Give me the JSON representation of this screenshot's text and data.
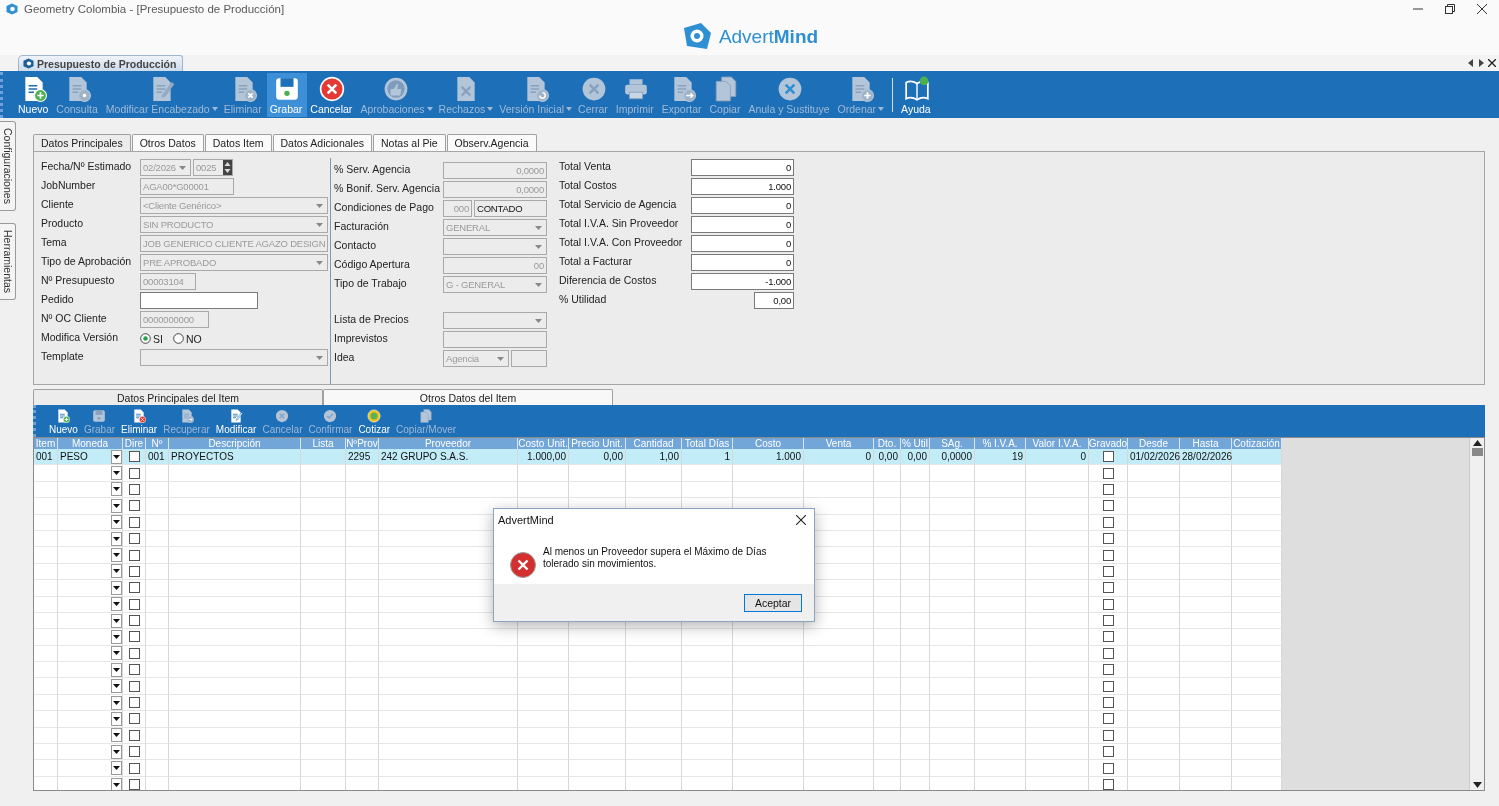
{
  "window": {
    "title": "Geometry Colombia - [Presupuesto de Producción]"
  },
  "logo": {
    "text": "Advert**Mind**"
  },
  "document_tab": {
    "label": "Presupuesto de Producción"
  },
  "toolbar_groups": [
    [
      {
        "label": "Nuevo",
        "kind": "new",
        "enabled": true,
        "selected": false,
        "dropdown": false
      },
      {
        "label": "Consulta",
        "kind": "query",
        "enabled": false,
        "selected": false,
        "dropdown": false
      },
      {
        "label": "Modificar Encabezado",
        "kind": "edit",
        "enabled": false,
        "selected": false,
        "dropdown": true
      },
      {
        "label": "Eliminar",
        "kind": "delete",
        "enabled": false,
        "selected": false,
        "dropdown": false
      },
      {
        "label": "Grabar",
        "kind": "save",
        "enabled": true,
        "selected": true,
        "dropdown": false
      },
      {
        "label": "Cancelar",
        "kind": "cancel",
        "enabled": true,
        "selected": false,
        "dropdown": false
      },
      {
        "label": "Aprobaciones",
        "kind": "approve",
        "enabled": false,
        "selected": false,
        "dropdown": true
      },
      {
        "label": "Rechazos",
        "kind": "reject",
        "enabled": false,
        "selected": false,
        "dropdown": true
      },
      {
        "label": "Versión Inicial",
        "kind": "version",
        "enabled": false,
        "selected": false,
        "dropdown": true
      },
      {
        "label": "Cerrar",
        "kind": "close",
        "enabled": false,
        "selected": false,
        "dropdown": false
      },
      {
        "label": "Imprimir",
        "kind": "print",
        "enabled": false,
        "selected": false,
        "dropdown": false
      },
      {
        "label": "Exportar",
        "kind": "export",
        "enabled": false,
        "selected": false,
        "dropdown": false
      },
      {
        "label": "Copiar",
        "kind": "copy",
        "enabled": false,
        "selected": false,
        "dropdown": false
      },
      {
        "label": "Anula y Sustituye",
        "kind": "void",
        "enabled": false,
        "selected": false,
        "dropdown": false
      },
      {
        "label": "Ordenar",
        "kind": "order",
        "enabled": false,
        "selected": false,
        "dropdown": true
      }
    ],
    [
      {
        "label": "Ayuda",
        "kind": "help",
        "enabled": true,
        "selected": false,
        "dropdown": false
      }
    ]
  ],
  "side_tabs": [
    {
      "label": "Configuraciones"
    },
    {
      "label": "Herramientas"
    }
  ],
  "form_tabs": [
    {
      "label": "Datos Principales",
      "selected": true
    },
    {
      "label": "Otros Datos",
      "selected": false
    },
    {
      "label": "Datos Item",
      "selected": false
    },
    {
      "label": "Datos Adicionales",
      "selected": false
    },
    {
      "label": "Notas al Pie",
      "selected": false
    },
    {
      "label": "Observ.Agencia",
      "selected": false
    }
  ],
  "general_fields": [
    {
      "label": "Fecha/Nº Estimado",
      "kind": "period",
      "value": "02/2026",
      "number": "0025",
      "disabled": true
    },
    {
      "label": "JobNumber",
      "kind": "text",
      "value": "AGA00*G00001",
      "disabled": true
    },
    {
      "label": "Cliente",
      "kind": "select",
      "value": "<Cliente Genérico>",
      "disabled": true
    },
    {
      "label": "Producto",
      "kind": "select",
      "value": "SIN PRODUCTO",
      "disabled": true
    },
    {
      "label": "Tema",
      "kind": "text",
      "value": "JOB GENERICO CLIENTE AGAZO DESIGN",
      "disabled": true
    },
    {
      "label": "Tipo de Aprobación",
      "kind": "select",
      "value": "PRE APROBADO",
      "disabled": true
    },
    {
      "label": "Nº Presupuesto",
      "kind": "text",
      "value": "00003104",
      "disabled": true
    },
    {
      "label": "Pedido",
      "kind": "text",
      "disabled": false
    },
    {
      "label": "Nº OC Cliente",
      "kind": "text",
      "value": "0000000000",
      "disabled": true
    },
    {
      "label": "Modifica Versión",
      "kind": "radio",
      "options": [
        {
          "label": "SI",
          "selected": true
        },
        {
          "label": "NO",
          "selected": false
        }
      ]
    },
    {
      "label": "Template",
      "kind": "select",
      "disabled": true
    }
  ],
  "agency_fields": [
    {
      "label": "% Serv. Agencia",
      "kind": "number",
      "value": "0,0000",
      "disabled": true
    },
    {
      "label": "% Bonif. Serv. Agencia",
      "kind": "number",
      "value": "0,0000",
      "disabled": true
    },
    {
      "label": "Condiciones de Pago",
      "kind": "code",
      "code": "000",
      "value": "CONTADO",
      "disabled": true
    },
    {
      "label": "Facturación",
      "kind": "select",
      "value": "GENERAL",
      "disabled": true
    },
    {
      "label": "Contacto",
      "kind": "select",
      "disabled": true
    },
    {
      "label": "Código Apertura",
      "kind": "number",
      "value": "00",
      "disabled": true
    },
    {
      "label": "Tipo de Trabajo",
      "kind": "select",
      "value": "G - GENERAL",
      "disabled": true
    }
  ],
  "price_fields": [
    {
      "label": "Lista de Precios",
      "kind": "select",
      "disabled": true
    },
    {
      "label": "Imprevistos",
      "kind": "text",
      "disabled": true
    },
    {
      "label": "Idea",
      "kind": "select_text",
      "value": "Agencia",
      "disabled": true
    }
  ],
  "totals": [
    {
      "label": "Total Venta",
      "value": "0"
    },
    {
      "label": "Total Costos",
      "value": "1.000"
    },
    {
      "label": "Total Servicio de Agencia",
      "value": "0"
    },
    {
      "label": "Total I.V.A. Sin Proveedor",
      "value": "0"
    },
    {
      "label": "Total I.V.A. Con Proveedor",
      "value": "0"
    },
    {
      "label": "Total a Facturar",
      "value": "0"
    },
    {
      "label": "Diferencia de Costos",
      "value": "-1.000"
    },
    {
      "label": "% Utilidad",
      "value": "0,00"
    }
  ],
  "item_tabs": [
    {
      "label": "Datos Principales del Item",
      "selected": true
    },
    {
      "label": "Otros Datos del Item",
      "selected": false
    }
  ],
  "item_toolbar": [
    {
      "label": "Nuevo",
      "kind": "new",
      "enabled": true
    },
    {
      "label": "Grabar",
      "kind": "save",
      "enabled": false
    },
    {
      "label": "Eliminar",
      "kind": "delete",
      "enabled": true
    },
    {
      "label": "Recuperar",
      "kind": "recover",
      "enabled": false
    },
    {
      "label": "Modificar",
      "kind": "edit",
      "enabled": true
    },
    {
      "label": "Cancelar",
      "kind": "close",
      "enabled": false
    },
    {
      "label": "Confirmar",
      "kind": "confirm",
      "enabled": false
    },
    {
      "label": "Cotizar",
      "kind": "quote",
      "enabled": true
    },
    {
      "label": "Copiar/Mover",
      "kind": "copy",
      "enabled": false
    }
  ],
  "grid": {
    "columns": [
      {
        "label": "Item",
        "kind": "text"
      },
      {
        "label": "Moneda",
        "kind": "dropdown"
      },
      {
        "label": "Dire",
        "kind": "checkbox"
      },
      {
        "label": "Nº",
        "kind": "text"
      },
      {
        "label": "Descripción",
        "kind": "text"
      },
      {
        "label": "Lista",
        "kind": "text"
      },
      {
        "label": "NºProv",
        "kind": "text"
      },
      {
        "label": "Proveedor",
        "kind": "text"
      },
      {
        "label": "Costo Unit.",
        "kind": "number"
      },
      {
        "label": "Precio Unit.",
        "kind": "number"
      },
      {
        "label": "Cantidad",
        "kind": "number"
      },
      {
        "label": "Total Días",
        "kind": "number"
      },
      {
        "label": "Costo",
        "kind": "number"
      },
      {
        "label": "Venta",
        "kind": "number"
      },
      {
        "label": "Dto.",
        "kind": "number"
      },
      {
        "label": "% Util",
        "kind": "number"
      },
      {
        "label": "SAg.",
        "kind": "number"
      },
      {
        "label": "% I.V.A.",
        "kind": "number"
      },
      {
        "label": "Valor I.V.A.",
        "kind": "number"
      },
      {
        "label": "Gravado",
        "kind": "checkbox"
      },
      {
        "label": "Desde",
        "kind": "text"
      },
      {
        "label": "Hasta",
        "kind": "text"
      },
      {
        "label": "Cotización",
        "kind": "text"
      }
    ],
    "rows": [
      {
        "selected": true,
        "cells": [
          "001",
          "PESO",
          false,
          "001",
          "PROYECTOS",
          null,
          "2295",
          "242 GRUPO S.A.S.",
          "1.000,00",
          "0,00",
          "1,00",
          "1",
          "1.000",
          "0",
          "0,00",
          "0,00",
          "0,0000",
          "19",
          "0",
          false,
          "01/02/2026",
          "28/02/2026",
          null
        ]
      },
      {
        "selected": false,
        "cells": [
          null,
          null,
          false,
          null,
          null,
          null,
          null,
          null,
          null,
          null,
          null,
          null,
          null,
          null,
          null,
          null,
          null,
          null,
          null,
          false,
          null,
          null,
          null
        ]
      },
      {
        "selected": false,
        "cells": [
          null,
          null,
          false,
          null,
          null,
          null,
          null,
          null,
          null,
          null,
          null,
          null,
          null,
          null,
          null,
          null,
          null,
          null,
          null,
          false,
          null,
          null,
          null
        ]
      },
      {
        "selected": false,
        "cells": [
          null,
          null,
          false,
          null,
          null,
          null,
          null,
          null,
          null,
          null,
          null,
          null,
          null,
          null,
          null,
          null,
          null,
          null,
          null,
          false,
          null,
          null,
          null
        ]
      },
      {
        "selected": false,
        "cells": [
          null,
          null,
          false,
          null,
          null,
          null,
          null,
          null,
          null,
          null,
          null,
          null,
          null,
          null,
          null,
          null,
          null,
          null,
          null,
          false,
          null,
          null,
          null
        ]
      },
      {
        "selected": false,
        "cells": [
          null,
          null,
          false,
          null,
          null,
          null,
          null,
          null,
          null,
          null,
          null,
          null,
          null,
          null,
          null,
          null,
          null,
          null,
          null,
          false,
          null,
          null,
          null
        ]
      },
      {
        "selected": false,
        "cells": [
          null,
          null,
          false,
          null,
          null,
          null,
          null,
          null,
          null,
          null,
          null,
          null,
          null,
          null,
          null,
          null,
          null,
          null,
          null,
          false,
          null,
          null,
          null
        ]
      },
      {
        "selected": false,
        "cells": [
          null,
          null,
          false,
          null,
          null,
          null,
          null,
          null,
          null,
          null,
          null,
          null,
          null,
          null,
          null,
          null,
          null,
          null,
          null,
          false,
          null,
          null,
          null
        ]
      },
      {
        "selected": false,
        "cells": [
          null,
          null,
          false,
          null,
          null,
          null,
          null,
          null,
          null,
          null,
          null,
          null,
          null,
          null,
          null,
          null,
          null,
          null,
          null,
          false,
          null,
          null,
          null
        ]
      },
      {
        "selected": false,
        "cells": [
          null,
          null,
          false,
          null,
          null,
          null,
          null,
          null,
          null,
          null,
          null,
          null,
          null,
          null,
          null,
          null,
          null,
          null,
          null,
          false,
          null,
          null,
          null
        ]
      },
      {
        "selected": false,
        "cells": [
          null,
          null,
          false,
          null,
          null,
          null,
          null,
          null,
          null,
          null,
          null,
          null,
          null,
          null,
          null,
          null,
          null,
          null,
          null,
          false,
          null,
          null,
          null
        ]
      },
      {
        "selected": false,
        "cells": [
          null,
          null,
          false,
          null,
          null,
          null,
          null,
          null,
          null,
          null,
          null,
          null,
          null,
          null,
          null,
          null,
          null,
          null,
          null,
          false,
          null,
          null,
          null
        ]
      },
      {
        "selected": false,
        "cells": [
          null,
          null,
          false,
          null,
          null,
          null,
          null,
          null,
          null,
          null,
          null,
          null,
          null,
          null,
          null,
          null,
          null,
          null,
          null,
          false,
          null,
          null,
          null
        ]
      },
      {
        "selected": false,
        "cells": [
          null,
          null,
          false,
          null,
          null,
          null,
          null,
          null,
          null,
          null,
          null,
          null,
          null,
          null,
          null,
          null,
          null,
          null,
          null,
          false,
          null,
          null,
          null
        ]
      },
      {
        "selected": false,
        "cells": [
          null,
          null,
          false,
          null,
          null,
          null,
          null,
          null,
          null,
          null,
          null,
          null,
          null,
          null,
          null,
          null,
          null,
          null,
          null,
          false,
          null,
          null,
          null
        ]
      },
      {
        "selected": false,
        "cells": [
          null,
          null,
          false,
          null,
          null,
          null,
          null,
          null,
          null,
          null,
          null,
          null,
          null,
          null,
          null,
          null,
          null,
          null,
          null,
          false,
          null,
          null,
          null
        ]
      },
      {
        "selected": false,
        "cells": [
          null,
          null,
          false,
          null,
          null,
          null,
          null,
          null,
          null,
          null,
          null,
          null,
          null,
          null,
          null,
          null,
          null,
          null,
          null,
          false,
          null,
          null,
          null
        ]
      },
      {
        "selected": false,
        "cells": [
          null,
          null,
          false,
          null,
          null,
          null,
          null,
          null,
          null,
          null,
          null,
          null,
          null,
          null,
          null,
          null,
          null,
          null,
          null,
          false,
          null,
          null,
          null
        ]
      },
      {
        "selected": false,
        "cells": [
          null,
          null,
          false,
          null,
          null,
          null,
          null,
          null,
          null,
          null,
          null,
          null,
          null,
          null,
          null,
          null,
          null,
          null,
          null,
          false,
          null,
          null,
          null
        ]
      },
      {
        "selected": false,
        "cells": [
          null,
          null,
          false,
          null,
          null,
          null,
          null,
          null,
          null,
          null,
          null,
          null,
          null,
          null,
          null,
          null,
          null,
          null,
          null,
          false,
          null,
          null,
          null
        ]
      },
      {
        "selected": false,
        "cells": [
          null,
          null,
          false,
          null,
          null,
          null,
          null,
          null,
          null,
          null,
          null,
          null,
          null,
          null,
          null,
          null,
          null,
          null,
          null,
          false,
          null,
          null,
          null
        ]
      }
    ]
  },
  "dialog": {
    "title": "AdvertMind",
    "message": "Al menos un Proveedor supera el Máximo de Días tolerado sin movimientos.",
    "button": "Aceptar"
  }
}
